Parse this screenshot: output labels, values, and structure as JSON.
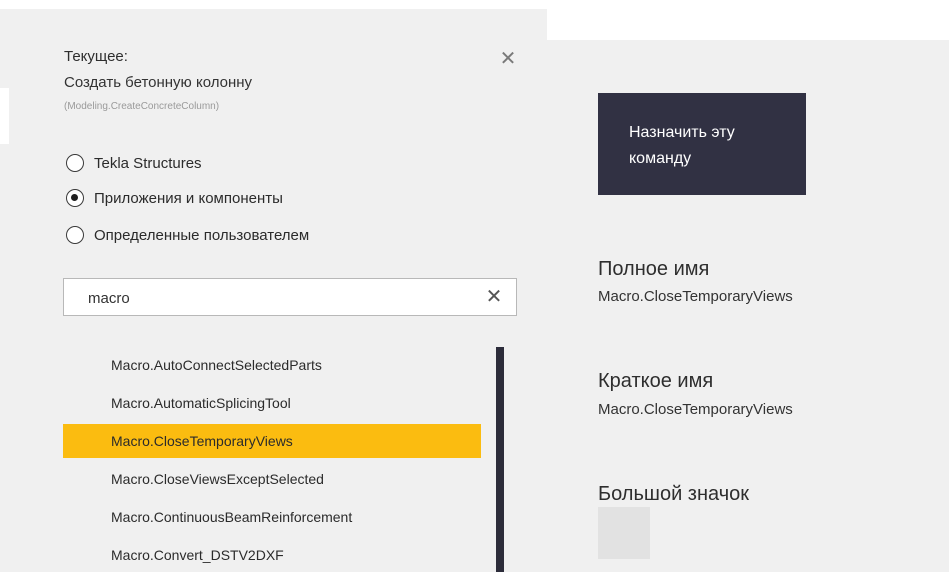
{
  "current": {
    "heading": "Текущее:",
    "name": "Создать бетонную колонну",
    "identifier": "(Modeling.CreateConcreteColumn)"
  },
  "close_icon": "close-icon",
  "filters": [
    {
      "label": "Tekla Structures",
      "checked": false
    },
    {
      "label": "Приложения и компоненты",
      "checked": true
    },
    {
      "label": "Определенные пользователем",
      "checked": false
    }
  ],
  "search": {
    "value": "macro",
    "placeholder": ""
  },
  "commands": [
    {
      "label": "Macro.AutoConnectSelectedParts",
      "selected": false
    },
    {
      "label": "Macro.AutomaticSplicingTool",
      "selected": false
    },
    {
      "label": "Macro.CloseTemporaryViews",
      "selected": true
    },
    {
      "label": "Macro.CloseViewsExceptSelected",
      "selected": false
    },
    {
      "label": "Macro.ContinuousBeamReinforcement",
      "selected": false
    },
    {
      "label": "Macro.Convert_DSTV2DXF",
      "selected": false
    }
  ],
  "assign_button": {
    "line1": "Назначить эту",
    "line2": "команду"
  },
  "details": {
    "full_name_label": "Полное имя",
    "full_name_value": "Macro.CloseTemporaryViews",
    "short_name_label": "Краткое имя",
    "short_name_value": "Macro.CloseTemporaryViews",
    "large_icon_label": "Большой значок"
  },
  "colors": {
    "selection": "#fbbc10",
    "button_bg": "#313143",
    "panel_bg": "#f0f0f0",
    "scrollbar": "#2c2c3a"
  }
}
